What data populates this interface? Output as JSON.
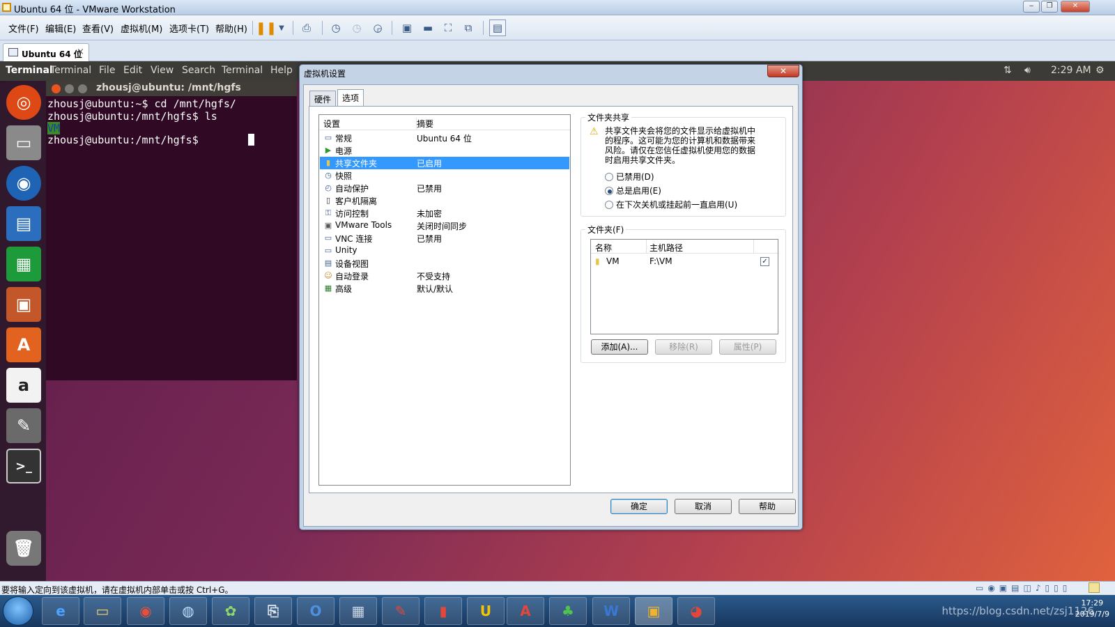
{
  "window": {
    "title": "Ubuntu 64 位 - VMware Workstation"
  },
  "menu": [
    "文件(F)",
    "编辑(E)",
    "查看(V)",
    "虚拟机(M)",
    "选项卡(T)",
    "帮助(H)"
  ],
  "tab": {
    "label": "Ubuntu 64 位"
  },
  "ubuntu_topbar": {
    "app": "Terminal",
    "menus": [
      "Terminal",
      "File",
      "Edit",
      "View",
      "Search",
      "Terminal",
      "Help"
    ],
    "time": "2:29 AM"
  },
  "terminal": {
    "title": "zhousj@ubuntu: /mnt/hgfs",
    "lines": [
      "zhousj@ubuntu:~$ cd /mnt/hgfs/",
      "zhousj@ubuntu:/mnt/hgfs$ ls",
      "VM",
      "zhousj@ubuntu:/mnt/hgfs$ "
    ]
  },
  "dialog": {
    "title": "虚拟机设置",
    "tabs": [
      "硬件",
      "选项"
    ],
    "list_headers": [
      "设置",
      "摘要"
    ],
    "items": [
      {
        "name": "常规",
        "summary": "Ubuntu 64 位"
      },
      {
        "name": "电源",
        "summary": ""
      },
      {
        "name": "共享文件夹",
        "summary": "已启用"
      },
      {
        "name": "快照",
        "summary": ""
      },
      {
        "name": "自动保护",
        "summary": "已禁用"
      },
      {
        "name": "客户机隔离",
        "summary": ""
      },
      {
        "name": "访问控制",
        "summary": "未加密"
      },
      {
        "name": "VMware Tools",
        "summary": "关闭时间同步"
      },
      {
        "name": "VNC 连接",
        "summary": "已禁用"
      },
      {
        "name": "Unity",
        "summary": ""
      },
      {
        "name": "设备视图",
        "summary": ""
      },
      {
        "name": "自动登录",
        "summary": "不受支持"
      },
      {
        "name": "高级",
        "summary": "默认/默认"
      }
    ],
    "sharing": {
      "title": "文件夹共享",
      "warning": [
        "共享文件夹会将您的文件显示给虚拟机中",
        "的程序。这可能为您的计算机和数据带来",
        "风险。请仅在您信任虚拟机使用您的数据",
        "时启用共享文件夹。"
      ],
      "options": [
        "已禁用(D)",
        "总是启用(E)",
        "在下次关机或挂起前一直启用(U)"
      ]
    },
    "folders": {
      "title": "文件夹(F)",
      "headers": [
        "名称",
        "主机路径"
      ],
      "rows": [
        {
          "name": "VM",
          "path": "F:\\VM"
        }
      ],
      "buttons": [
        "添加(A)...",
        "移除(R)",
        "属性(P)"
      ]
    },
    "footer": [
      "确定",
      "取消",
      "帮助"
    ]
  },
  "statusbar": {
    "text": "要将输入定向到该虚拟机，请在虚拟机内部单击或按 Ctrl+G。"
  },
  "taskbar": {
    "time": "17:29",
    "date": "2019/7/9",
    "watermark": "https://blog.csdn.net/zsj1126"
  }
}
